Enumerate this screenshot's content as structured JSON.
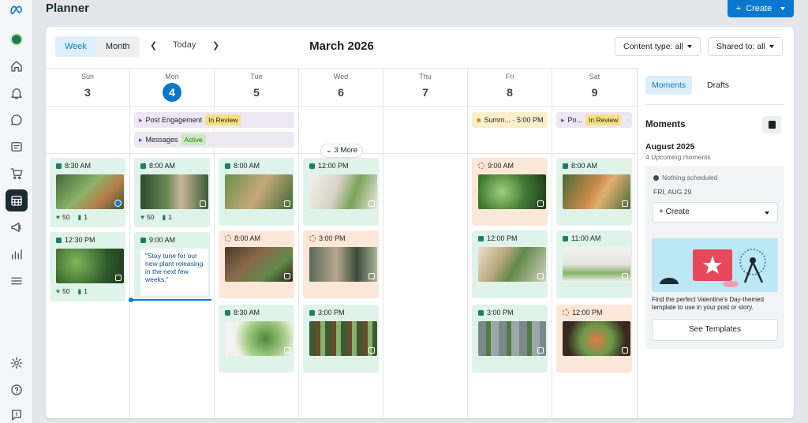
{
  "app": {
    "title": "Planner",
    "create_label": "Create"
  },
  "toolbar": {
    "week_label": "Week",
    "month_label": "Month",
    "today_label": "Today",
    "title": "March 2026",
    "content_filter": "Content type: all",
    "shared_filter": "Shared to: all"
  },
  "days": [
    {
      "dow": "Sun",
      "num": "3"
    },
    {
      "dow": "Mon",
      "num": "4"
    },
    {
      "dow": "Tue",
      "num": "5"
    },
    {
      "dow": "Wed",
      "num": "6"
    },
    {
      "dow": "Thu",
      "num": "7"
    },
    {
      "dow": "Fri",
      "num": "8"
    },
    {
      "dow": "Sat",
      "num": "9"
    }
  ],
  "events": {
    "post_engagement": {
      "label": "Post Engagement",
      "status": "In Review"
    },
    "messages": {
      "label": "Messages",
      "status": "Active"
    },
    "summit": {
      "label": "Summ... · 5:00 PM"
    },
    "sat_po": {
      "label": "Po...",
      "status": "In Review"
    }
  },
  "more_label": "3 More",
  "posts": {
    "sun1": {
      "time": "8:30 AM",
      "likes": "50",
      "comments": "1"
    },
    "sun2": {
      "time": "12:30 PM",
      "likes": "50",
      "comments": "1"
    },
    "mon1": {
      "time": "8:00 AM",
      "likes": "50",
      "comments": "1"
    },
    "mon2": {
      "time": "9:00 AM",
      "text": "\"Stay tune for our new plant releasing in the next few weeks.\""
    },
    "tue1": {
      "time": "8:00 AM"
    },
    "tue2": {
      "time": "8:00 AM"
    },
    "tue3": {
      "time": "8:30 AM"
    },
    "wed1": {
      "time": "12:00 PM"
    },
    "wed2": {
      "time": "3:00 PM"
    },
    "wed3": {
      "time": "3:00 PM"
    },
    "fri1": {
      "time": "9:00 AM"
    },
    "fri2": {
      "time": "12:00 PM"
    },
    "fri3": {
      "time": "3:00 PM"
    },
    "sat1": {
      "time": "8:00 AM"
    },
    "sat2": {
      "time": "11:00 AM"
    },
    "sat3": {
      "time": "12:00 PM"
    }
  },
  "side": {
    "tab_moments": "Moments",
    "tab_drafts": "Drafts",
    "heading": "Moments",
    "month": "August 2025",
    "upcoming": "4 Upcoming moments",
    "nothing": "Nothing scheduled",
    "date": "FRI, AUG 29",
    "create_label": "+ Create",
    "description": "Find the perfect Valentine's Day-themed template to use in your post or story.",
    "see_templates": "See Templates"
  },
  "colors": {
    "accent": "#0a78d1",
    "green_post": "#e0f3ea",
    "orange_post": "#fde7d9"
  }
}
